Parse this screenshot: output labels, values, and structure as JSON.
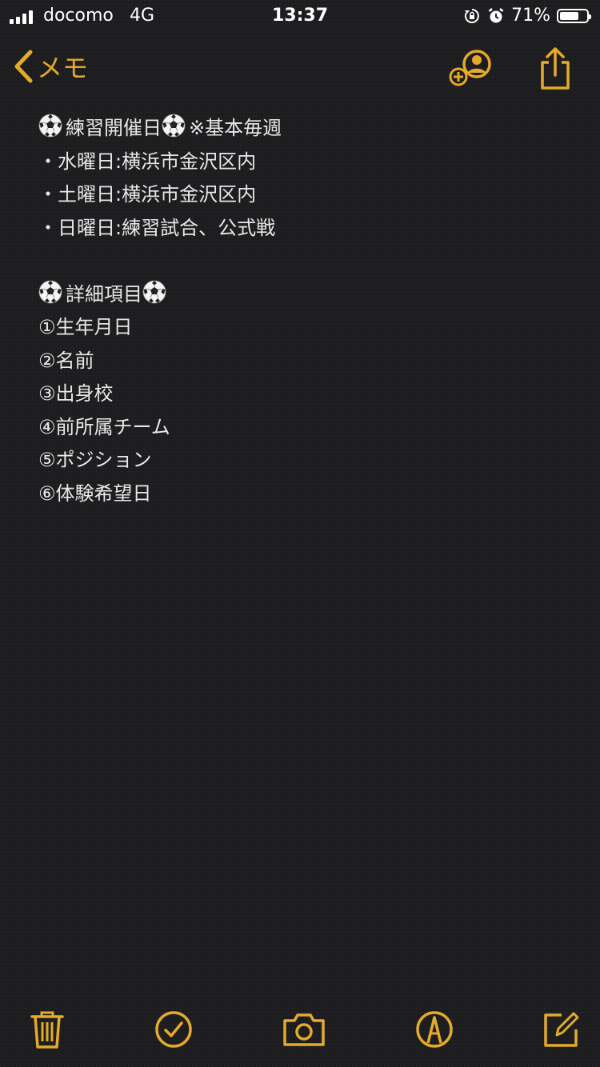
{
  "status_bar": {
    "carrier": "docomo",
    "network": "4G",
    "time": "13:37",
    "battery_label": "71%",
    "battery_level": 0.71
  },
  "nav": {
    "back_label": "メモ",
    "accent": "#e3aa2c"
  },
  "note": {
    "lines": [
      {
        "segments": [
          "",
          "練習開催日",
          "※基本毎週"
        ]
      },
      "・水曜日:横浜市金沢区内",
      "・土曜日:横浜市金沢区内",
      "・日曜日:練習試合、公式戦",
      "",
      {
        "segments": [
          "",
          "詳細項目",
          ""
        ]
      },
      "①生年月日",
      "②名前",
      "③出身校",
      "④前所属チーム",
      "⑤ポジション",
      "⑥体験希望日"
    ]
  },
  "icons": {
    "back": "chevron-left-icon",
    "add_person": "add-person-icon",
    "share": "share-icon",
    "trash": "trash-icon",
    "checklist": "checkmark-circle-icon",
    "camera": "camera-icon",
    "markup": "markup-pen-icon",
    "compose": "compose-icon",
    "soccer": "soccer-ball-icon"
  }
}
